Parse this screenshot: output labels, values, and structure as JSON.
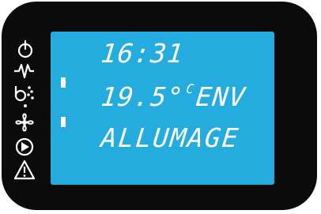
{
  "display": {
    "time": "16:31",
    "temperature": "19.5°",
    "temperature_unit": "C",
    "mode": "ENV",
    "status": "ALLUMAGE"
  },
  "icons": [
    "power-icon",
    "heating-element-icon",
    "pellet-feed-icon",
    "fan-icon",
    "play-icon",
    "alarm-icon"
  ],
  "colors": {
    "bezel": "#0b0b0b",
    "lcd_background": "#24acdf",
    "lcd_text": "#ffffff",
    "icon_color": "#ffffff"
  }
}
